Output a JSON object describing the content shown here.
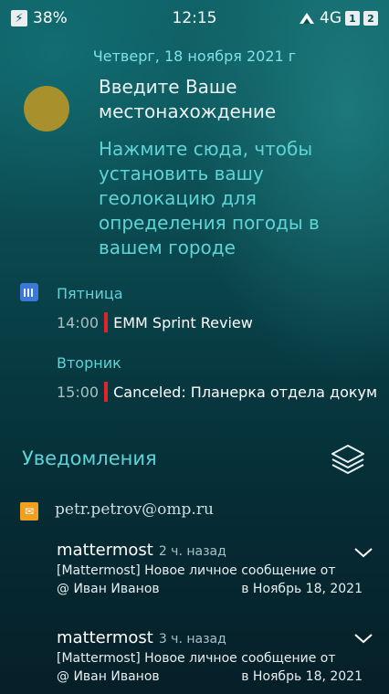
{
  "status_bar": {
    "battery": "38%",
    "time": "12:15",
    "network": "4G",
    "sim1": "1",
    "sim2": "2"
  },
  "date": "Четверг, 18 ноября 2021 г",
  "weather": {
    "title": "Введите Ваше местонахождение",
    "hint": "Нажмите сюда, чтобы установить вашу геолокацию для определения погоды в вашем городе"
  },
  "calendar": {
    "days": [
      {
        "label": "Пятница",
        "time": "14:00",
        "event": "EMM Sprint Review"
      },
      {
        "label": "Вторник",
        "time": "15:00",
        "event": "Canceled: Планерка отдела докум"
      }
    ]
  },
  "notifications": {
    "title": "Уведомления",
    "account": "petr.petrov@omp.ru",
    "items": [
      {
        "app": "mattermost",
        "ago": "2 ч. назад",
        "body": "[Mattermost] Новое личное сообщение от",
        "from": "@ Иван Иванов",
        "date": "в Ноябрь 18, 2021"
      },
      {
        "app": "mattermost",
        "ago": "3 ч. назад",
        "body": "[Mattermost] Новое личное сообщение от",
        "from": "@  Иван Иванов",
        "date": "в Ноябрь 18, 2021"
      }
    ]
  },
  "icons": {
    "battery": "lightning-icon",
    "network": "signal-icon",
    "calendar": "calendar-icon",
    "layers": "layers-icon",
    "account": "mail-app-icon",
    "expand": "chevron-down-icon"
  },
  "colors": {
    "accent": "#5fd3d6",
    "event_marker": "#e0242e",
    "sun": "#a8902c"
  }
}
